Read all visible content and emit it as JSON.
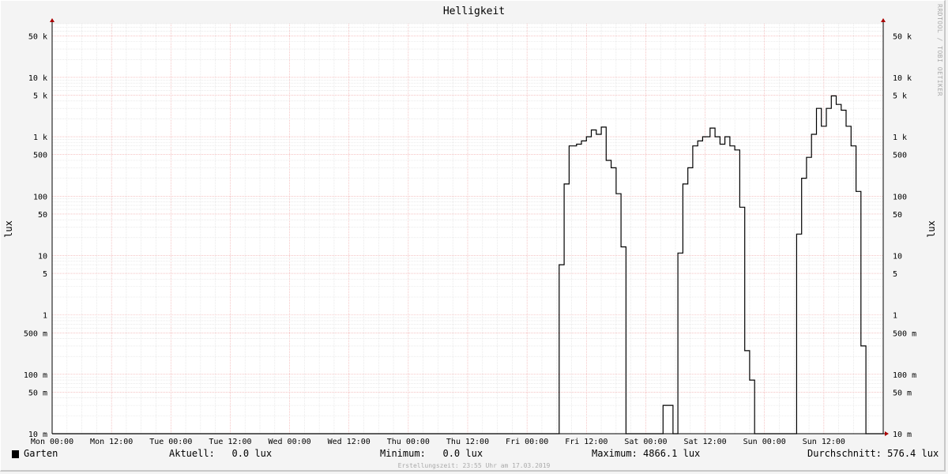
{
  "chart_data": {
    "type": "line",
    "title": "Helligkeit",
    "ylabel": "lux",
    "y_scale": "log",
    "ylim": [
      0.01,
      80000
    ],
    "xlim": [
      "Mon 00:00",
      "Mon 00:00 (+7d)"
    ],
    "grid": true,
    "x_ticks": [
      "Mon 00:00",
      "Mon 12:00",
      "Tue 00:00",
      "Tue 12:00",
      "Wed 00:00",
      "Wed 12:00",
      "Thu 00:00",
      "Thu 12:00",
      "Fri 00:00",
      "Fri 12:00",
      "Sat 00:00",
      "Sat 12:00",
      "Sun 00:00",
      "Sun 12:00"
    ],
    "y_ticks": [
      {
        "value": 50000,
        "label": "50 k"
      },
      {
        "value": 10000,
        "label": "10 k"
      },
      {
        "value": 5000,
        "label": "5 k"
      },
      {
        "value": 1000,
        "label": "1 k"
      },
      {
        "value": 500,
        "label": "500"
      },
      {
        "value": 100,
        "label": "100"
      },
      {
        "value": 50,
        "label": "50"
      },
      {
        "value": 10,
        "label": "10"
      },
      {
        "value": 5,
        "label": "5"
      },
      {
        "value": 1,
        "label": "1"
      },
      {
        "value": 0.5,
        "label": "500 m"
      },
      {
        "value": 0.1,
        "label": "100 m"
      },
      {
        "value": 0.05,
        "label": "50 m"
      },
      {
        "value": 0.01,
        "label": "10 m"
      }
    ],
    "series": [
      {
        "name": "Garten",
        "color": "#000000",
        "points_hours": [
          [
            0,
            0
          ],
          [
            102.5,
            0
          ],
          [
            102.5,
            7
          ],
          [
            103.5,
            7
          ],
          [
            103.5,
            160
          ],
          [
            104.5,
            160
          ],
          [
            104.5,
            700
          ],
          [
            106,
            700
          ],
          [
            106,
            750
          ],
          [
            107,
            750
          ],
          [
            107,
            850
          ],
          [
            108,
            850
          ],
          [
            108,
            1000
          ],
          [
            109,
            1000
          ],
          [
            109,
            1300
          ],
          [
            110,
            1300
          ],
          [
            110,
            1100
          ],
          [
            111,
            1100
          ],
          [
            111,
            1450
          ],
          [
            112,
            1450
          ],
          [
            112,
            400
          ],
          [
            113,
            400
          ],
          [
            113,
            300
          ],
          [
            114,
            300
          ],
          [
            114,
            110
          ],
          [
            115,
            110
          ],
          [
            115,
            14
          ],
          [
            116,
            14
          ],
          [
            116,
            0
          ],
          [
            123.5,
            0
          ],
          [
            123.5,
            0.03
          ],
          [
            125.5,
            0.03
          ],
          [
            125.5,
            0
          ],
          [
            126.5,
            0
          ],
          [
            126.5,
            11
          ],
          [
            127.5,
            11
          ],
          [
            127.5,
            160
          ],
          [
            128.5,
            160
          ],
          [
            128.5,
            300
          ],
          [
            129.5,
            300
          ],
          [
            129.5,
            700
          ],
          [
            130.5,
            700
          ],
          [
            130.5,
            850
          ],
          [
            131.5,
            850
          ],
          [
            131.5,
            1000
          ],
          [
            133,
            1000
          ],
          [
            133,
            1400
          ],
          [
            134,
            1400
          ],
          [
            134,
            1000
          ],
          [
            135,
            1000
          ],
          [
            135,
            750
          ],
          [
            136,
            750
          ],
          [
            136,
            1000
          ],
          [
            137,
            1000
          ],
          [
            137,
            700
          ],
          [
            138,
            700
          ],
          [
            138,
            600
          ],
          [
            139,
            600
          ],
          [
            139,
            65
          ],
          [
            140,
            65
          ],
          [
            140,
            0.25
          ],
          [
            141,
            0.25
          ],
          [
            141,
            0.08
          ],
          [
            142,
            0.08
          ],
          [
            142,
            0
          ],
          [
            150.5,
            0
          ],
          [
            150.5,
            23
          ],
          [
            151.5,
            23
          ],
          [
            151.5,
            200
          ],
          [
            152.5,
            200
          ],
          [
            152.5,
            450
          ],
          [
            153.5,
            450
          ],
          [
            153.5,
            1100
          ],
          [
            154.5,
            1100
          ],
          [
            154.5,
            3000
          ],
          [
            155.5,
            3000
          ],
          [
            155.5,
            1500
          ],
          [
            156.5,
            1500
          ],
          [
            156.5,
            3000
          ],
          [
            157.5,
            3000
          ],
          [
            157.5,
            4866
          ],
          [
            158.5,
            4866
          ],
          [
            158.5,
            3500
          ],
          [
            159.5,
            3500
          ],
          [
            159.5,
            2800
          ],
          [
            160.5,
            2800
          ],
          [
            160.5,
            1500
          ],
          [
            161.5,
            1500
          ],
          [
            161.5,
            700
          ],
          [
            162.5,
            700
          ],
          [
            162.5,
            120
          ],
          [
            163.5,
            120
          ],
          [
            163.5,
            0.3
          ],
          [
            164.5,
            0.3
          ],
          [
            164.5,
            0
          ],
          [
            168,
            0
          ]
        ]
      }
    ]
  },
  "legend": {
    "series_label": "Garten",
    "current": "Aktuell:   0.0 lux",
    "minimum": "Minimum:   0.0 lux",
    "maximum": "Maximum: 4866.1 lux",
    "average": "Durchschnitt: 576.4 lux"
  },
  "footer": "Erstellungszeit: 23:55 Uhr am 17.03.2019",
  "watermark": "RRDTOOL / TOBI OETIKER"
}
